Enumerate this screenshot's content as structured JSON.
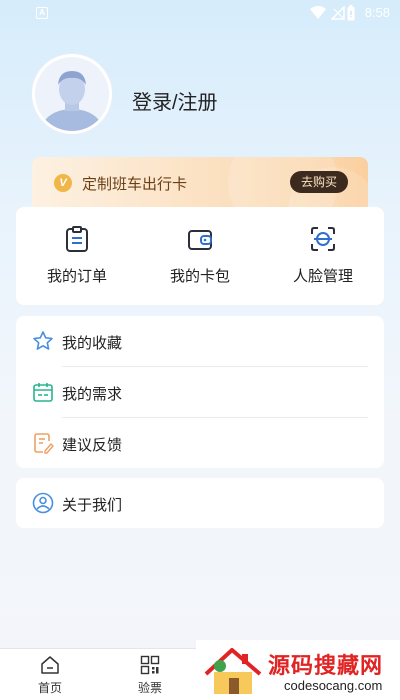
{
  "status_bar": {
    "time": "8:58",
    "notification_icon": "a-icon"
  },
  "profile": {
    "login_label": "登录/注册",
    "avatar_icon": "user-avatar-icon"
  },
  "vip": {
    "badge": "V",
    "label": "定制班车出行卡",
    "buy_label": "去购买"
  },
  "shortcuts": [
    {
      "label": "我的订单",
      "icon": "order-clipboard-icon"
    },
    {
      "label": "我的卡包",
      "icon": "wallet-icon"
    },
    {
      "label": "人脸管理",
      "icon": "face-scan-icon"
    }
  ],
  "menu": [
    {
      "label": "我的收藏",
      "icon": "star-icon"
    },
    {
      "label": "我的需求",
      "icon": "calendar-icon"
    },
    {
      "label": "建议反馈",
      "icon": "feedback-icon"
    }
  ],
  "about": {
    "label": "关于我们",
    "icon": "user-circle-icon"
  },
  "bottom_nav": [
    {
      "label": "首页",
      "icon": "home-icon"
    },
    {
      "label": "验票",
      "icon": "qr-code-icon"
    }
  ],
  "watermark": {
    "title": "源码搜藏网",
    "url": "codesocang.com"
  },
  "colors": {
    "accent_blue": "#2f6fd0",
    "vip_text": "#6b3f16",
    "buy_bg": "#3d2a1e",
    "watermark_red": "#e02424"
  }
}
